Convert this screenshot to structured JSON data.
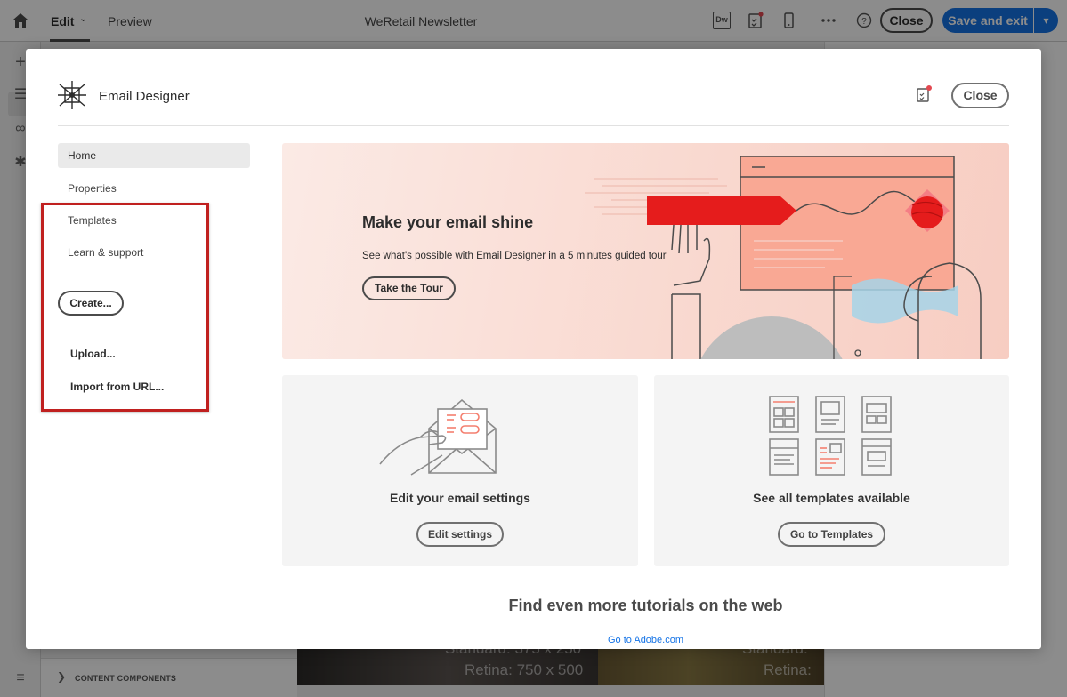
{
  "app": {
    "nav": {
      "edit_label": "Edit",
      "preview_label": "Preview"
    },
    "document_title": "WeRetail Newsletter",
    "toolbar": {
      "dw_label": "Dw",
      "close_label": "Close",
      "save_label": "Save and exit"
    },
    "left_panel": {
      "content_components_label": "CONTENT COMPONENTS"
    },
    "canvas": {
      "image_caption_1": "Standard: 375 x 250",
      "image_caption_2": "Retina: 750 x 500",
      "image_caption_3": "Standard:",
      "image_caption_4": "Retina:"
    }
  },
  "modal": {
    "title": "Email Designer",
    "close_label": "Close",
    "sidebar": {
      "items": [
        {
          "label": "Home",
          "active": true
        },
        {
          "label": "Properties",
          "active": false
        },
        {
          "label": "Templates",
          "active": false
        },
        {
          "label": "Learn & support",
          "active": false
        }
      ],
      "create_label": "Create...",
      "menu": {
        "upload_label": "Upload...",
        "import_label": "Import from URL..."
      }
    },
    "hero": {
      "title": "Make your email shine",
      "description": "See what's possible with Email Designer in a 5 minutes guided tour",
      "button_label": "Take the Tour"
    },
    "cards": [
      {
        "title": "Edit your email settings",
        "button_label": "Edit settings",
        "icon": "email-settings-illustration"
      },
      {
        "title": "See all templates available",
        "button_label": "Go to Templates",
        "icon": "templates-grid-illustration"
      }
    ],
    "tutorials": {
      "heading": "Find even more tutorials on the web",
      "link_label": "Go to Adobe.com"
    }
  },
  "colors": {
    "accent_blue": "#1473e6",
    "highlight_red": "#c0201f",
    "hero_red": "#e51c1c",
    "notification_dot": "#e34850"
  }
}
